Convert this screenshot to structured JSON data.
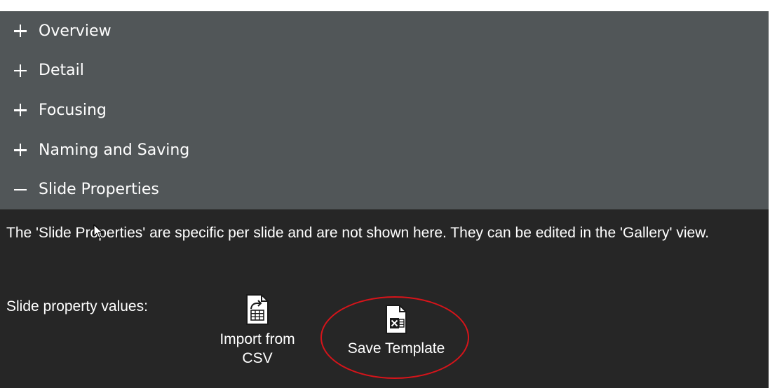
{
  "sections": [
    {
      "label": "Overview",
      "expanded": false
    },
    {
      "label": "Detail",
      "expanded": false
    },
    {
      "label": "Focusing",
      "expanded": false
    },
    {
      "label": "Naming and Saving",
      "expanded": false
    },
    {
      "label": "Slide Properties",
      "expanded": true
    }
  ],
  "content": {
    "description": "The 'Slide Properties' are specific per slide and are not shown here. They can be edited in the 'Gallery' view.",
    "slide_property_label": "Slide property values:",
    "import_button": {
      "label": "Import from CSV",
      "icon": "csv-file-icon"
    },
    "save_button": {
      "label": "Save Template",
      "icon": "excel-file-icon"
    }
  },
  "colors": {
    "header_bg": "#515658",
    "content_bg": "#262626",
    "highlight_circle": "#d7141a"
  }
}
